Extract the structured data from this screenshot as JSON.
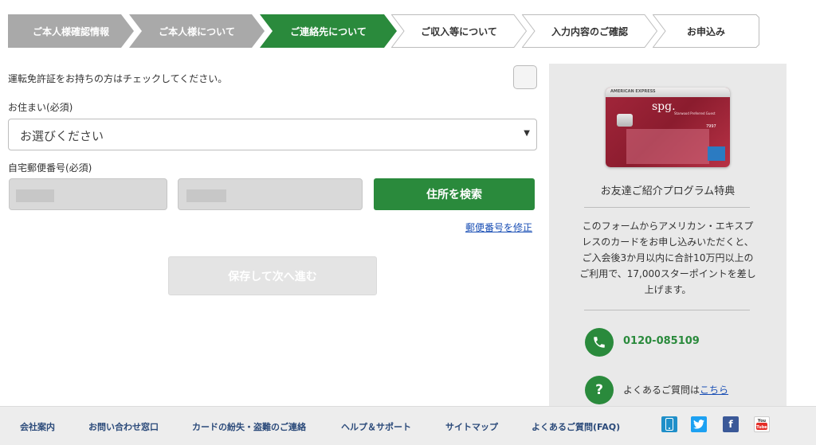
{
  "steps": [
    {
      "label": "ご本人様確認情報",
      "state": "done"
    },
    {
      "label": "ご本人様について",
      "state": "done"
    },
    {
      "label": "ご連絡先について",
      "state": "active"
    },
    {
      "label": "ご収入等について",
      "state": "todo"
    },
    {
      "label": "入力内容のご確認",
      "state": "todo"
    },
    {
      "label": "お申込み",
      "state": "todo"
    }
  ],
  "form": {
    "license_label": "運転免許証をお持ちの方はチェックしてください。",
    "residence_label": "お住まい(必須)",
    "residence_value": "お選びください",
    "zip_label": "自宅郵便番号(必須)",
    "search_button": "住所を検索",
    "fix_zip_link": "郵便番号を修正",
    "save_button": "保存して次へ進む"
  },
  "sidebar": {
    "card_brand": "AMERICAN EXPRESS",
    "card_logo": "spg.",
    "card_sub": "Starwood Preferred Guest",
    "card_number": "7997",
    "program_title": "お友達ご紹介プログラム特典",
    "program_desc": "このフォームからアメリカン・エキスプレスのカードをお申し込みいただくと、ご入会後3か月以内に合計10万円以上のご利用で、17,000スターポイントを差し上げます。",
    "phone": "0120-085109",
    "faq_text": "よくあるご質問は",
    "faq_link": "こちら"
  },
  "footer": {
    "links": [
      "会社案内",
      "お問い合わせ窓口",
      "カードの紛失・盗難のご連絡",
      "ヘルプ＆サポート",
      "サイトマップ",
      "よくあるご質問(FAQ)"
    ],
    "social": [
      "mobile-icon",
      "twitter-icon",
      "facebook-icon",
      "youtube-icon"
    ]
  },
  "colors": {
    "done": "#a9a9a9",
    "active": "#2a8a3c",
    "todo_border": "#bcbcbc",
    "green": "#2a8a3c",
    "link": "#1a4fb5"
  }
}
